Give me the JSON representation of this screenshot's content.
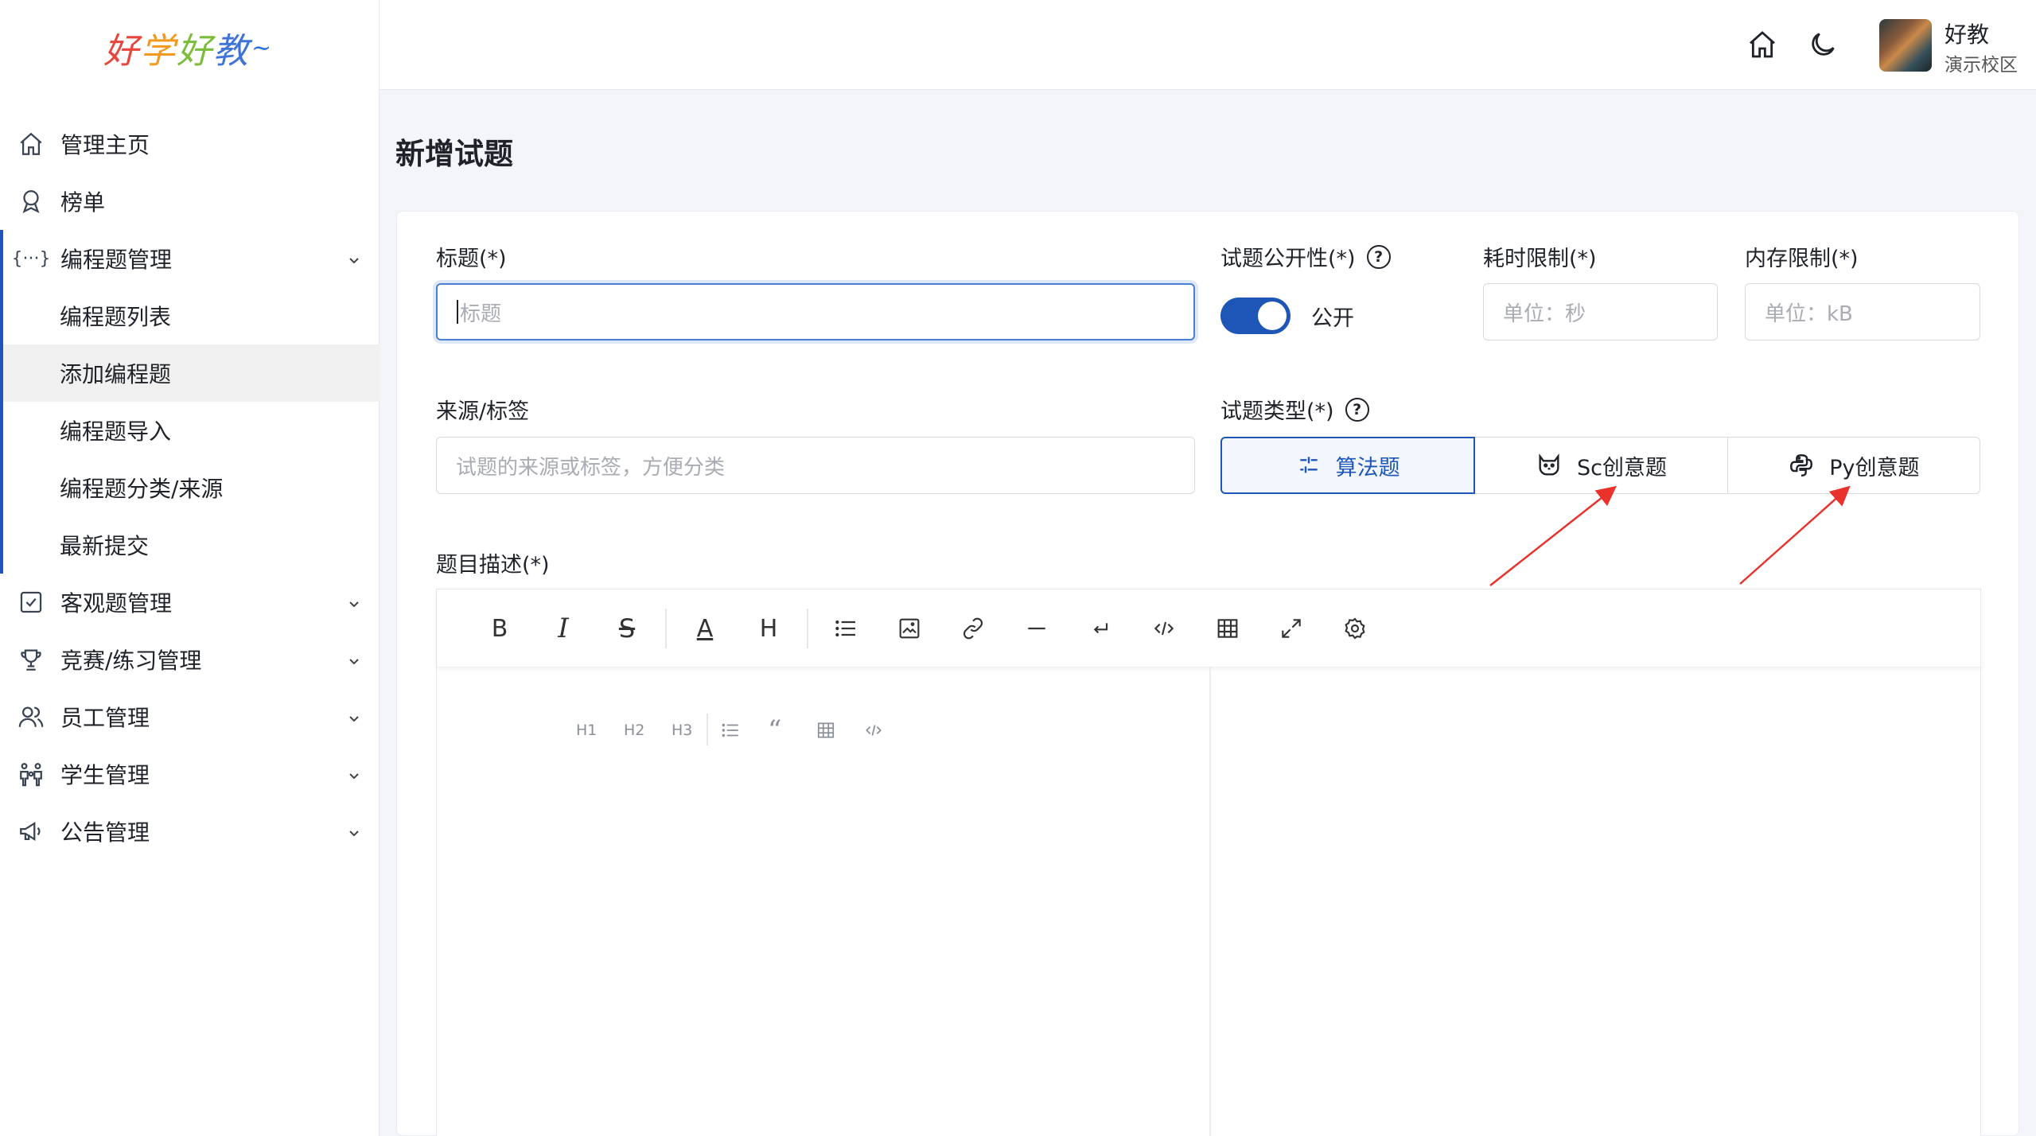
{
  "sidebar": {
    "logo_text": "好学好教",
    "items": [
      {
        "label": "管理主页",
        "icon": "home-icon"
      },
      {
        "label": "榜单",
        "icon": "award-icon"
      },
      {
        "label": "编程题管理",
        "icon": "code-braces-icon"
      },
      {
        "label": "客观题管理",
        "icon": "checkbox-icon"
      },
      {
        "label": "竞赛/练习管理",
        "icon": "trophy-icon"
      },
      {
        "label": "员工管理",
        "icon": "users-icon"
      },
      {
        "label": "学生管理",
        "icon": "students-icon"
      },
      {
        "label": "公告管理",
        "icon": "megaphone-icon"
      }
    ],
    "sub_items": [
      {
        "label": "编程题列表"
      },
      {
        "label": "添加编程题",
        "active": true
      },
      {
        "label": "编程题导入"
      },
      {
        "label": "编程题分类/来源"
      },
      {
        "label": "最新提交"
      }
    ]
  },
  "header": {
    "user_name": "好教",
    "campus": "演示校区"
  },
  "page": {
    "title": "新增试题"
  },
  "form": {
    "title_label": "标题(*)",
    "title_placeholder": "标题",
    "public_label": "试题公开性(*)",
    "public_value": "公开",
    "public_on": true,
    "time_label": "耗时限制(*)",
    "time_placeholder": "单位：秒",
    "memory_label": "内存限制(*)",
    "memory_placeholder": "单位：kB",
    "source_label": "来源/标签",
    "source_placeholder": "试题的来源或标签，方便分类",
    "type_label": "试题类型(*)",
    "types": [
      "算法题",
      "Sc创意题",
      "Py创意题"
    ],
    "selected_type": "算法题",
    "desc_label": "题目描述(*)"
  },
  "editor": {
    "mini_toolbar": [
      "H1",
      "H2",
      "H3"
    ]
  },
  "colors": {
    "primary": "#1e56b7",
    "annotation_arrow": "#e8322b"
  }
}
